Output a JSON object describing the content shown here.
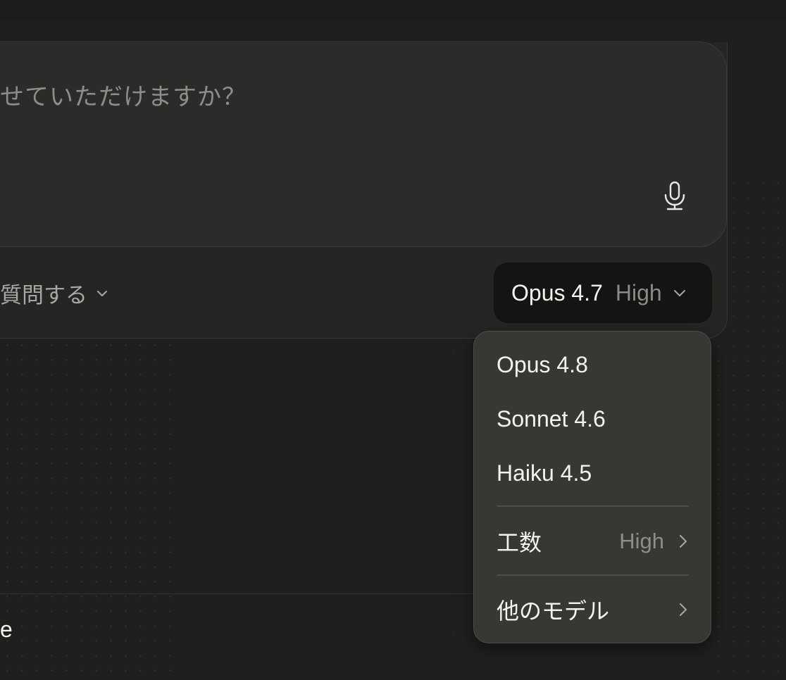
{
  "composer": {
    "placeholder": "せていただけますか？",
    "mode_label": "質問する"
  },
  "model_selector": {
    "model": "Opus 4.7",
    "effort": "High"
  },
  "dropdown": {
    "models": [
      {
        "label": "Opus 4.8"
      },
      {
        "label": "Sonnet 4.6"
      },
      {
        "label": "Haiku 4.5"
      }
    ],
    "effort": {
      "label": "工数",
      "value": "High"
    },
    "more_models": {
      "label": "他のモデル"
    }
  },
  "footer": {
    "fragment": "e"
  },
  "icons": {
    "mic": "microphone-icon",
    "chevron_down": "chevron-down-icon",
    "chevron_right": "chevron-right-icon"
  },
  "colors": {
    "background": "#1f1f1e",
    "composer": "#2b2b2a",
    "selector": "#141414",
    "dropdown": "#373734",
    "text": "#f4f2ec",
    "muted": "#8f8d88"
  }
}
